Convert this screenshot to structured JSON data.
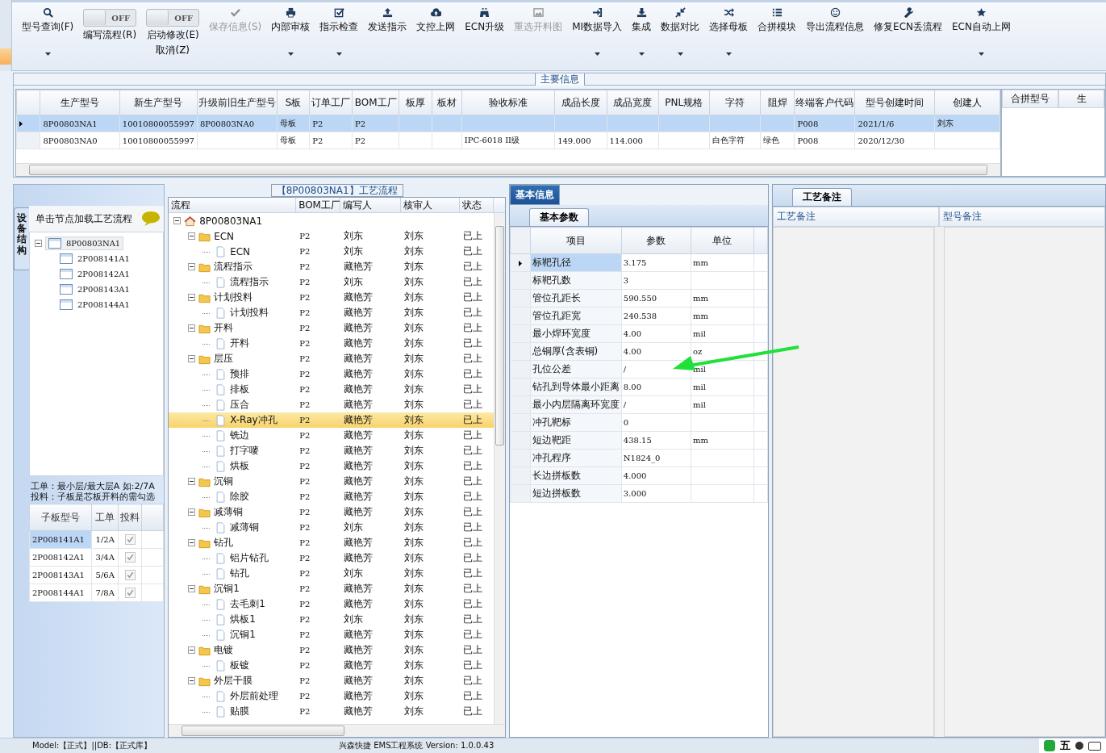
{
  "toolbar": [
    {
      "kind": "button",
      "label": "型号查询(F)",
      "disabled": false,
      "dropdown": true
    },
    {
      "kind": "toggle",
      "label": "编写流程(R)",
      "switch_text": "OFF",
      "on": false
    },
    {
      "kind": "toggle",
      "label": "启动修改(E)",
      "sublabel": "取消(Z)",
      "switch_text": "OFF",
      "on": false
    },
    {
      "kind": "button",
      "label": "保存信息(S)",
      "disabled": true,
      "dropdown": false
    },
    {
      "kind": "button",
      "label": "内部审核",
      "disabled": false,
      "dropdown": true
    },
    {
      "kind": "button",
      "label": "指示检查",
      "disabled": false,
      "dropdown": true
    },
    {
      "kind": "button",
      "label": "发送指示",
      "disabled": false,
      "dropdown": false
    },
    {
      "kind": "button",
      "label": "文控上网",
      "disabled": false,
      "dropdown": false
    },
    {
      "kind": "button",
      "label": "ECN升级",
      "disabled": false,
      "dropdown": false
    },
    {
      "kind": "button",
      "label": "重选开料图",
      "disabled": true,
      "dropdown": false
    },
    {
      "kind": "button",
      "label": "MI数据导入",
      "disabled": false,
      "dropdown": true
    },
    {
      "kind": "button",
      "label": "集成",
      "disabled": false,
      "dropdown": true
    },
    {
      "kind": "button",
      "label": "数据对比",
      "disabled": false,
      "dropdown": true
    },
    {
      "kind": "button",
      "label": "选择母板",
      "disabled": false,
      "dropdown": true
    },
    {
      "kind": "button",
      "label": "合拼模块",
      "disabled": false,
      "dropdown": false
    },
    {
      "kind": "button",
      "label": "导出流程信息",
      "disabled": false,
      "dropdown": false
    },
    {
      "kind": "button",
      "label": "修复ECN丢流程",
      "disabled": false,
      "dropdown": false
    },
    {
      "kind": "button",
      "label": "ECN自动上网",
      "disabled": false,
      "dropdown": true
    }
  ],
  "main_info": {
    "title": "主要信息",
    "columns": [
      "生产型号",
      "新生产型号",
      "升级前旧生产型号",
      "S板",
      "订单工厂",
      "BOM工厂",
      "板厚",
      "板材",
      "验收标准",
      "成品长度",
      "成品宽度",
      "PNL规格",
      "字符",
      "阻焊",
      "终端客户代码",
      "型号创建时间",
      "创建人"
    ],
    "rows": [
      {
        "selected": true,
        "cells": [
          "8P00803NA1",
          "10010800055997",
          "8P00803NA0",
          "母板",
          "P2",
          "P2",
          "",
          "",
          "",
          "",
          "",
          "",
          "",
          "",
          "P008",
          "2021/1/6",
          "刘东"
        ]
      },
      {
        "selected": false,
        "cells": [
          "8P00803NA0",
          "10010800055997",
          "",
          "母板",
          "P2",
          "P2",
          "",
          "",
          "IPC-6018 II级",
          "149.000",
          "114.000",
          "",
          "白色字符",
          "绿色",
          "P008",
          "2020/12/30",
          ""
        ]
      }
    ],
    "side_columns": [
      "合拼型号",
      "生"
    ]
  },
  "structure_panel": {
    "tab": "设备结构",
    "header": "单击节点加载工艺流程",
    "tree": {
      "label": "8P00803NA1",
      "expanded": true,
      "children": [
        {
          "label": "2P008141A1"
        },
        {
          "label": "2P008142A1"
        },
        {
          "label": "2P008143A1"
        },
        {
          "label": "2P008144A1"
        }
      ]
    },
    "notes": [
      "工单：最小层/最大层A 如:2/7A",
      "投料：子板是芯板开料的需勾选"
    ],
    "columns": [
      "子板型号",
      "工单",
      "投料"
    ],
    "rows": [
      {
        "board": "2P008141A1",
        "order": "1/2A",
        "checked": true,
        "selected": true
      },
      {
        "board": "2P008142A1",
        "order": "3/4A",
        "checked": true,
        "selected": false
      },
      {
        "board": "2P008143A1",
        "order": "5/6A",
        "checked": true,
        "selected": false
      },
      {
        "board": "2P008144A1",
        "order": "7/8A",
        "checked": true,
        "selected": false
      }
    ]
  },
  "flow_panel": {
    "title": "【8P00803NA1】工艺流程",
    "columns": [
      "流程",
      "BOM工厂",
      "编写人",
      "核审人",
      "状态"
    ],
    "tree": {
      "label": "8P00803NA1",
      "kind": "root",
      "selected": false,
      "expanded": true,
      "children": [
        {
          "label": "ECN",
          "kind": "folder",
          "selected": false,
          "expanded": true,
          "cells": [
            "P2",
            "刘东",
            "刘东",
            "已上"
          ],
          "children": [
            {
              "label": "ECN",
              "kind": "file",
              "selected": false,
              "cells": [
                "P2",
                "刘东",
                "刘东",
                "已上"
              ]
            }
          ]
        },
        {
          "label": "流程指示",
          "kind": "folder",
          "selected": false,
          "expanded": true,
          "cells": [
            "P2",
            "藏艳芳",
            "刘东",
            "已上"
          ],
          "children": [
            {
              "label": "流程指示",
              "kind": "file",
              "selected": false,
              "cells": [
                "P2",
                "刘东",
                "刘东",
                "已上"
              ]
            }
          ]
        },
        {
          "label": "计划投料",
          "kind": "folder",
          "selected": false,
          "expanded": true,
          "cells": [
            "P2",
            "藏艳芳",
            "刘东",
            "已上"
          ],
          "children": [
            {
              "label": "计划投料",
              "kind": "file",
              "selected": false,
              "cells": [
                "P2",
                "藏艳芳",
                "刘东",
                "已上"
              ]
            }
          ]
        },
        {
          "label": "开料",
          "kind": "folder",
          "selected": false,
          "expanded": true,
          "cells": [
            "P2",
            "藏艳芳",
            "刘东",
            "已上"
          ],
          "children": [
            {
              "label": "开料",
              "kind": "file",
              "selected": false,
              "cells": [
                "P2",
                "藏艳芳",
                "刘东",
                "已上"
              ]
            }
          ]
        },
        {
          "label": "层压",
          "kind": "folder",
          "selected": false,
          "expanded": true,
          "cells": [
            "P2",
            "藏艳芳",
            "刘东",
            "已上"
          ],
          "children": [
            {
              "label": "预排",
              "kind": "file",
              "selected": false,
              "cells": [
                "P2",
                "藏艳芳",
                "刘东",
                "已上"
              ]
            },
            {
              "label": "排板",
              "kind": "file",
              "selected": false,
              "cells": [
                "P2",
                "藏艳芳",
                "刘东",
                "已上"
              ]
            },
            {
              "label": "压合",
              "kind": "file",
              "selected": false,
              "cells": [
                "P2",
                "藏艳芳",
                "刘东",
                "已上"
              ]
            },
            {
              "label": "X-Ray冲孔",
              "kind": "file",
              "selected": true,
              "cells": [
                "P2",
                "藏艳芳",
                "刘东",
                "已上"
              ]
            },
            {
              "label": "铣边",
              "kind": "file",
              "selected": false,
              "cells": [
                "P2",
                "藏艳芳",
                "刘东",
                "已上"
              ]
            },
            {
              "label": "打字嘜",
              "kind": "file",
              "selected": false,
              "cells": [
                "P2",
                "藏艳芳",
                "刘东",
                "已上"
              ]
            },
            {
              "label": "烘板",
              "kind": "file",
              "selected": false,
              "cells": [
                "P2",
                "藏艳芳",
                "刘东",
                "已上"
              ]
            }
          ]
        },
        {
          "label": "沉铜",
          "kind": "folder",
          "selected": false,
          "expanded": true,
          "cells": [
            "P2",
            "藏艳芳",
            "刘东",
            "已上"
          ],
          "children": [
            {
              "label": "除胶",
              "kind": "file",
              "selected": false,
              "cells": [
                "P2",
                "藏艳芳",
                "刘东",
                "已上"
              ]
            }
          ]
        },
        {
          "label": "减薄铜",
          "kind": "folder",
          "selected": false,
          "expanded": true,
          "cells": [
            "P2",
            "藏艳芳",
            "刘东",
            "已上"
          ],
          "children": [
            {
              "label": "减薄铜",
              "kind": "file",
              "selected": false,
              "cells": [
                "P2",
                "刘东",
                "刘东",
                "已上"
              ]
            }
          ]
        },
        {
          "label": "钻孔",
          "kind": "folder",
          "selected": false,
          "expanded": true,
          "cells": [
            "P2",
            "藏艳芳",
            "刘东",
            "已上"
          ],
          "children": [
            {
              "label": "铝片钻孔",
              "kind": "file",
              "selected": false,
              "cells": [
                "P2",
                "藏艳芳",
                "刘东",
                "已上"
              ]
            },
            {
              "label": "钻孔",
              "kind": "file",
              "selected": false,
              "cells": [
                "P2",
                "刘东",
                "刘东",
                "已上"
              ]
            }
          ]
        },
        {
          "label": "沉铜1",
          "kind": "folder",
          "selected": false,
          "expanded": true,
          "cells": [
            "P2",
            "藏艳芳",
            "刘东",
            "已上"
          ],
          "children": [
            {
              "label": "去毛刺1",
              "kind": "file",
              "selected": false,
              "cells": [
                "P2",
                "藏艳芳",
                "刘东",
                "已上"
              ]
            },
            {
              "label": "烘板1",
              "kind": "file",
              "selected": false,
              "cells": [
                "P2",
                "刘东",
                "刘东",
                "已上"
              ]
            },
            {
              "label": "沉铜1",
              "kind": "file",
              "selected": false,
              "cells": [
                "P2",
                "藏艳芳",
                "刘东",
                "已上"
              ]
            }
          ]
        },
        {
          "label": "电镀",
          "kind": "folder",
          "selected": false,
          "expanded": true,
          "cells": [
            "P2",
            "藏艳芳",
            "刘东",
            "已上"
          ],
          "children": [
            {
              "label": "板镀",
              "kind": "file",
              "selected": false,
              "cells": [
                "P2",
                "藏艳芳",
                "刘东",
                "已上"
              ]
            }
          ]
        },
        {
          "label": "外层干膜",
          "kind": "folder",
          "selected": false,
          "expanded": true,
          "cells": [
            "P2",
            "藏艳芳",
            "刘东",
            "已上"
          ],
          "children": [
            {
              "label": "外层前处理",
              "kind": "file",
              "selected": false,
              "cells": [
                "P2",
                "藏艳芳",
                "刘东",
                "已上"
              ]
            },
            {
              "label": "贴膜",
              "kind": "file",
              "selected": false,
              "cells": [
                "P2",
                "藏艳芳",
                "刘东",
                "已上"
              ]
            }
          ]
        }
      ]
    }
  },
  "info_panel": {
    "tabs": [
      {
        "label": "基本信息",
        "selected": true
      }
    ],
    "subtab": "基本参数",
    "columns": [
      "项目",
      "参数",
      "单位"
    ],
    "rows": [
      {
        "item": "标靶孔径",
        "value": "3.175",
        "unit": "mm",
        "selected": true
      },
      {
        "item": "标靶孔数",
        "value": "3",
        "unit": "",
        "selected": false
      },
      {
        "item": "管位孔距长",
        "value": "590.550",
        "unit": "mm",
        "selected": false
      },
      {
        "item": "管位孔距宽",
        "value": "240.538",
        "unit": "mm",
        "selected": false
      },
      {
        "item": "最小焊环宽度",
        "value": "4.00",
        "unit": "mil",
        "selected": false
      },
      {
        "item": "总铜厚(含表铜)",
        "value": "4.00",
        "unit": "oz",
        "selected": false
      },
      {
        "item": "孔位公差",
        "value": "/",
        "unit": "mil",
        "selected": false
      },
      {
        "item": "钻孔到导体最小距离",
        "value": "8.00",
        "unit": "mil",
        "selected": false
      },
      {
        "item": "最小内层隔离环宽度",
        "value": "/",
        "unit": "mil",
        "selected": false
      },
      {
        "item": "冲孔靶标",
        "value": "0",
        "unit": "",
        "selected": false
      },
      {
        "item": "短边靶距",
        "value": "438.15",
        "unit": "mm",
        "selected": false
      },
      {
        "item": "冲孔程序",
        "value": "N1824_0",
        "unit": "",
        "selected": false
      },
      {
        "item": "长边拼板数",
        "value": "4.000",
        "unit": "",
        "selected": false
      },
      {
        "item": "短边拼板数",
        "value": "3.000",
        "unit": "",
        "selected": false
      }
    ],
    "annotations": [
      {
        "kind": "arrow"
      }
    ]
  },
  "remarks_panel": {
    "tab": "工艺备注",
    "columns": [
      "工艺备注",
      "型号备注"
    ]
  },
  "status_bar": {
    "left": "Model:【正式】||DB:【正式库】",
    "center": "兴森快捷 EMS工程系统 Version: 1.0.0.43",
    "ime": "五"
  }
}
